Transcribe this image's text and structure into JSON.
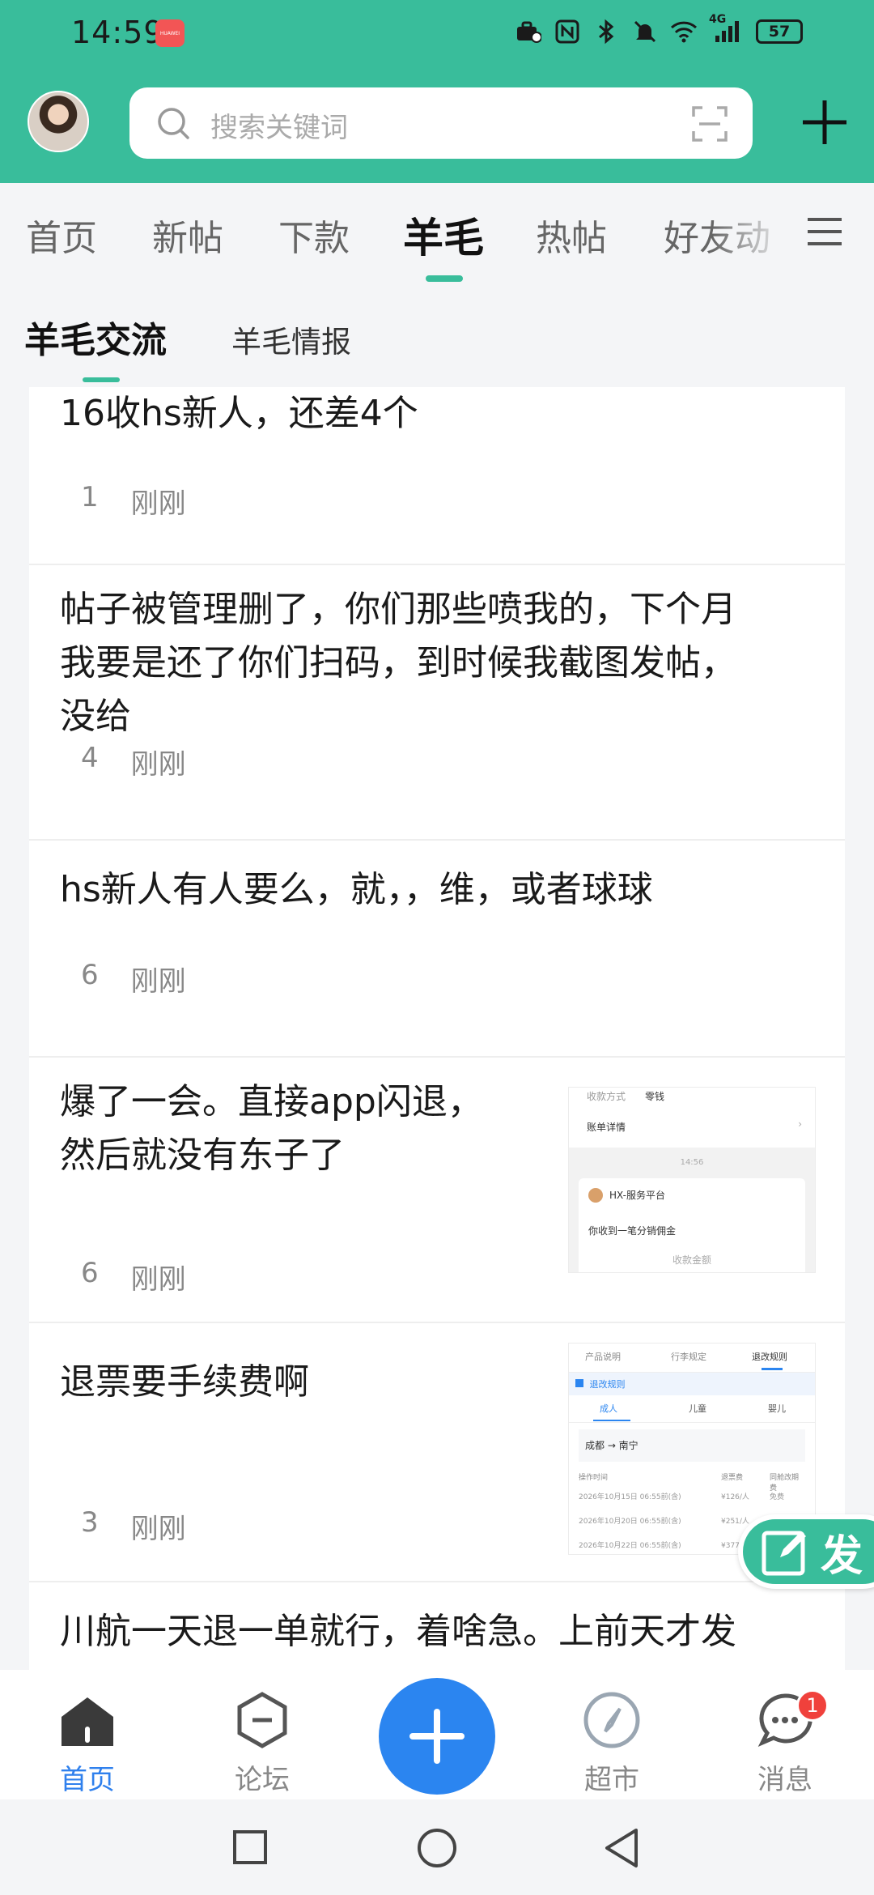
{
  "status_bar": {
    "time": "14:59",
    "app_badge": "HUAWEI",
    "battery": "57",
    "network": "4G"
  },
  "header": {
    "search_placeholder": "搜索关键词"
  },
  "tabs": [
    {
      "label": "首页"
    },
    {
      "label": "新帖"
    },
    {
      "label": "下款"
    },
    {
      "label": "羊毛"
    },
    {
      "label": "热帖"
    },
    {
      "label": "好友动"
    }
  ],
  "sub_tabs": [
    {
      "label": "羊毛交流"
    },
    {
      "label": "羊毛情报"
    }
  ],
  "posts": [
    {
      "title": "16收hs新人，还差4个",
      "count": "1",
      "time": "刚刚"
    },
    {
      "title_lines": [
        "帖子被管理删了，你们那些喷我的，下个月",
        "我要是还了你们扫码，到时候我截图发帖，",
        "没给"
      ],
      "count": "4",
      "time": "刚刚"
    },
    {
      "title": "hs新人有人要么，就，，维，或者球球",
      "count": "6",
      "time": "刚刚"
    },
    {
      "title_lines": [
        "爆了一会。直接app闪退，",
        "然后就没有东子了"
      ],
      "count": "6",
      "time": "刚刚",
      "thumb": {
        "row1_label": "收款方式",
        "row1_value": "零钱",
        "row2": "账单详情",
        "time": "14:56",
        "sender": "HX-服务平台",
        "message": "你收到一笔分销佣金",
        "footer": "收款金额"
      }
    },
    {
      "title": "退票要手续费啊",
      "count": "3",
      "time": "刚刚",
      "thumb": {
        "tabs": [
          "产品说明",
          "行李规定",
          "退改规则"
        ],
        "header": "退改规则",
        "pax": [
          "成人",
          "儿童",
          "婴儿"
        ],
        "route": "成都 → 南宁",
        "cols": [
          "操作时间",
          "退票费",
          "同舱改期费"
        ],
        "rows": [
          [
            "2026年10月15日 06:55前(含)",
            "¥126/人",
            "免费"
          ],
          [
            "2026年10月20日 06:55前(含)",
            "¥251/人",
            "免费"
          ],
          [
            "2026年10月22日 06:55前(含)",
            "¥377/人",
            "..."
          ]
        ]
      }
    },
    {
      "title": "川航一天退一单就行，着啥急。上前天才发"
    }
  ],
  "fab_label": "发",
  "bottom_nav": [
    {
      "label": "首页",
      "icon": "home-icon",
      "active": true
    },
    {
      "label": "论坛",
      "icon": "forum-icon"
    },
    {
      "label": "超市",
      "icon": "compass-icon"
    },
    {
      "label": "消息",
      "icon": "message-icon",
      "badge": "1"
    }
  ],
  "colors": {
    "brand": "#39bd9b",
    "accent": "#2b85f0",
    "badge": "#f0413c"
  }
}
